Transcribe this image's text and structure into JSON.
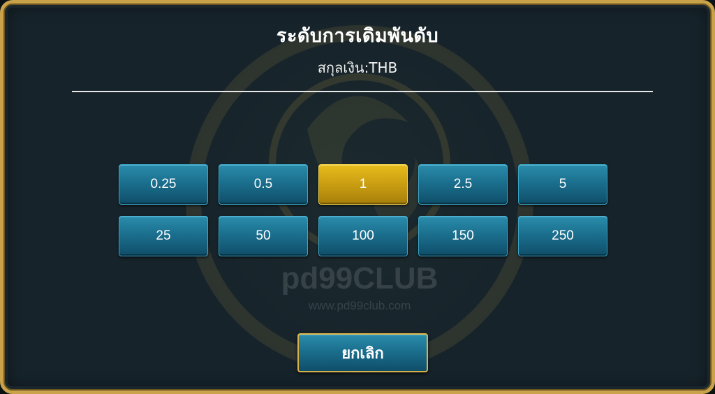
{
  "dialog": {
    "title": "ระดับการเดิมพันดับ",
    "subtitle": "สกุลเงิน:THB",
    "cancel_label": "ยกเลิก"
  },
  "bet_levels": {
    "selected": "1",
    "rows": [
      [
        "0.25",
        "0.5",
        "1",
        "2.5",
        "5"
      ],
      [
        "25",
        "50",
        "100",
        "150",
        "250"
      ]
    ]
  },
  "watermark": {
    "brand": "pd99CLUB",
    "url": "www.pd99club.com"
  },
  "colors": {
    "frame_gold": "#c9a24a",
    "panel": "#16232a",
    "chip_teal": "#1b6f8e",
    "chip_selected": "#e7bd1c"
  }
}
